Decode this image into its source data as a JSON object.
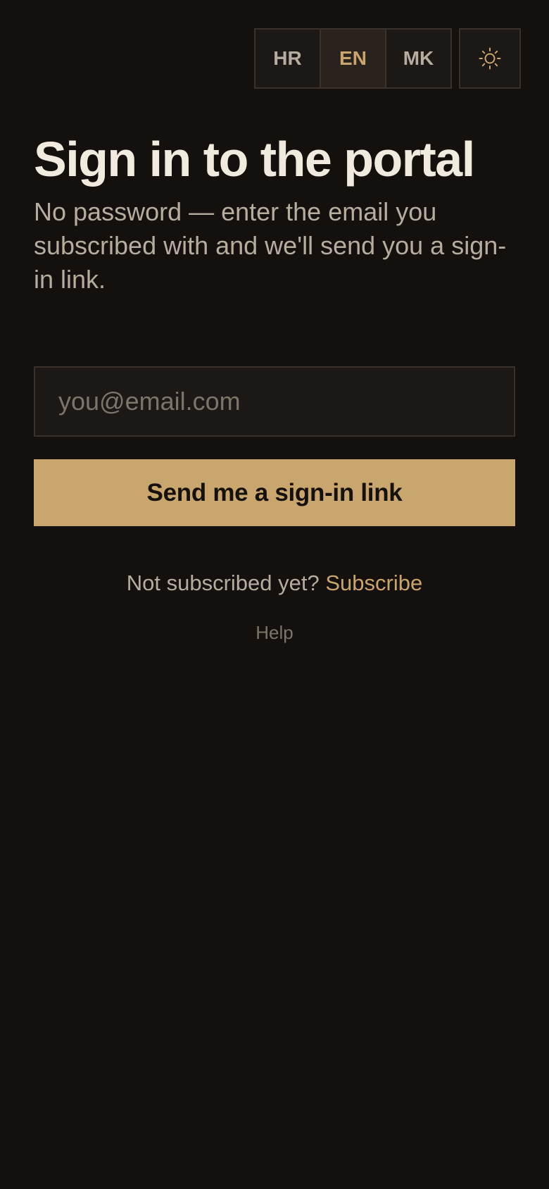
{
  "header": {
    "languages": [
      {
        "code": "HR",
        "active": false
      },
      {
        "code": "EN",
        "active": true
      },
      {
        "code": "MK",
        "active": false
      }
    ],
    "theme_icon": "sun-icon"
  },
  "main": {
    "title": "Sign in to the portal",
    "subtitle": "No password — enter the email you subscribed with and we'll send you a sign-in link.",
    "email_placeholder": "you@email.com",
    "email_value": "",
    "submit_label": "Send me a sign-in link",
    "signup_prompt": "Not subscribed yet?",
    "signup_link": "Subscribe",
    "help_link": "Help"
  },
  "colors": {
    "background": "#13100e",
    "accent": "#c9a46d",
    "button": "#c9a66d",
    "text_primary": "#f1ebdf",
    "text_secondary": "#b6ad9f",
    "text_muted": "#7d746a",
    "border": "#3a312a"
  }
}
